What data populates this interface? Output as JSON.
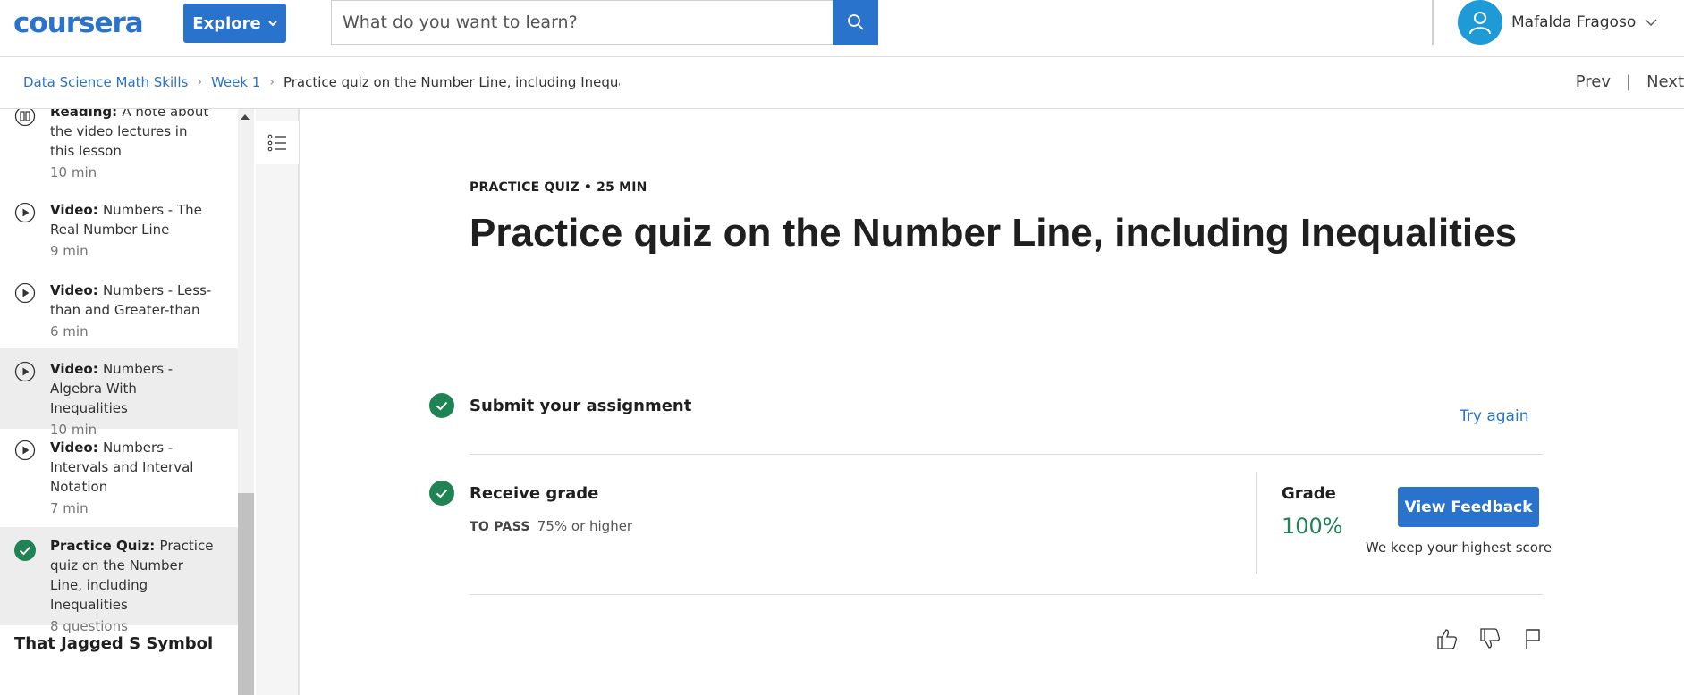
{
  "header": {
    "logo_text": "coursera",
    "explore_label": "Explore",
    "search_placeholder": "What do you want to learn?",
    "user_name": "Mafalda Fragoso"
  },
  "breadcrumb": {
    "items": [
      "Data Science Math Skills",
      "Week 1"
    ],
    "current": "Practice quiz on the Number Line, including Inequaliti"
  },
  "nav": {
    "prev": "Prev",
    "next": "Next"
  },
  "sidebar": {
    "items": [
      {
        "type": "Reading:",
        "title": "A note about the video lectures in this lesson",
        "meta": "10 min",
        "icon": "reading-icon",
        "active": false
      },
      {
        "type": "Video:",
        "title": "Numbers - The Real Number Line",
        "meta": "9 min",
        "icon": "play-icon",
        "active": false
      },
      {
        "type": "Video:",
        "title": "Numbers - Less-than and Greater-than",
        "meta": "6 min",
        "icon": "play-icon",
        "active": false
      },
      {
        "type": "Video:",
        "title": "Numbers - Algebra With Inequalities",
        "meta": "10 min",
        "icon": "play-icon",
        "active": true
      },
      {
        "type": "Video:",
        "title": "Numbers - Intervals and Interval Notation",
        "meta": "7 min",
        "icon": "play-icon",
        "active": false
      },
      {
        "type": "Practice Quiz:",
        "title": "Practice quiz on the Number Line, including Inequalities",
        "meta": "8 questions",
        "icon": "check-circle-icon",
        "active": true
      }
    ],
    "next_section": "That Jagged S Symbol"
  },
  "main": {
    "eyebrow": "PRACTICE QUIZ • 25 MIN",
    "title": "Practice quiz on the Number Line, including Inequalities",
    "submit_title": "Submit your assignment",
    "try_again": "Try again",
    "receive_title": "Receive grade",
    "to_pass_label": "TO PASS",
    "to_pass_value": "75% or higher",
    "grade_label": "Grade",
    "grade_value": "100%",
    "feedback_button": "View Feedback",
    "keep_note": "We keep your highest score"
  },
  "colors": {
    "brand": "#2a73cc",
    "success": "#1f8354",
    "avatar": "#1e9bd7"
  }
}
